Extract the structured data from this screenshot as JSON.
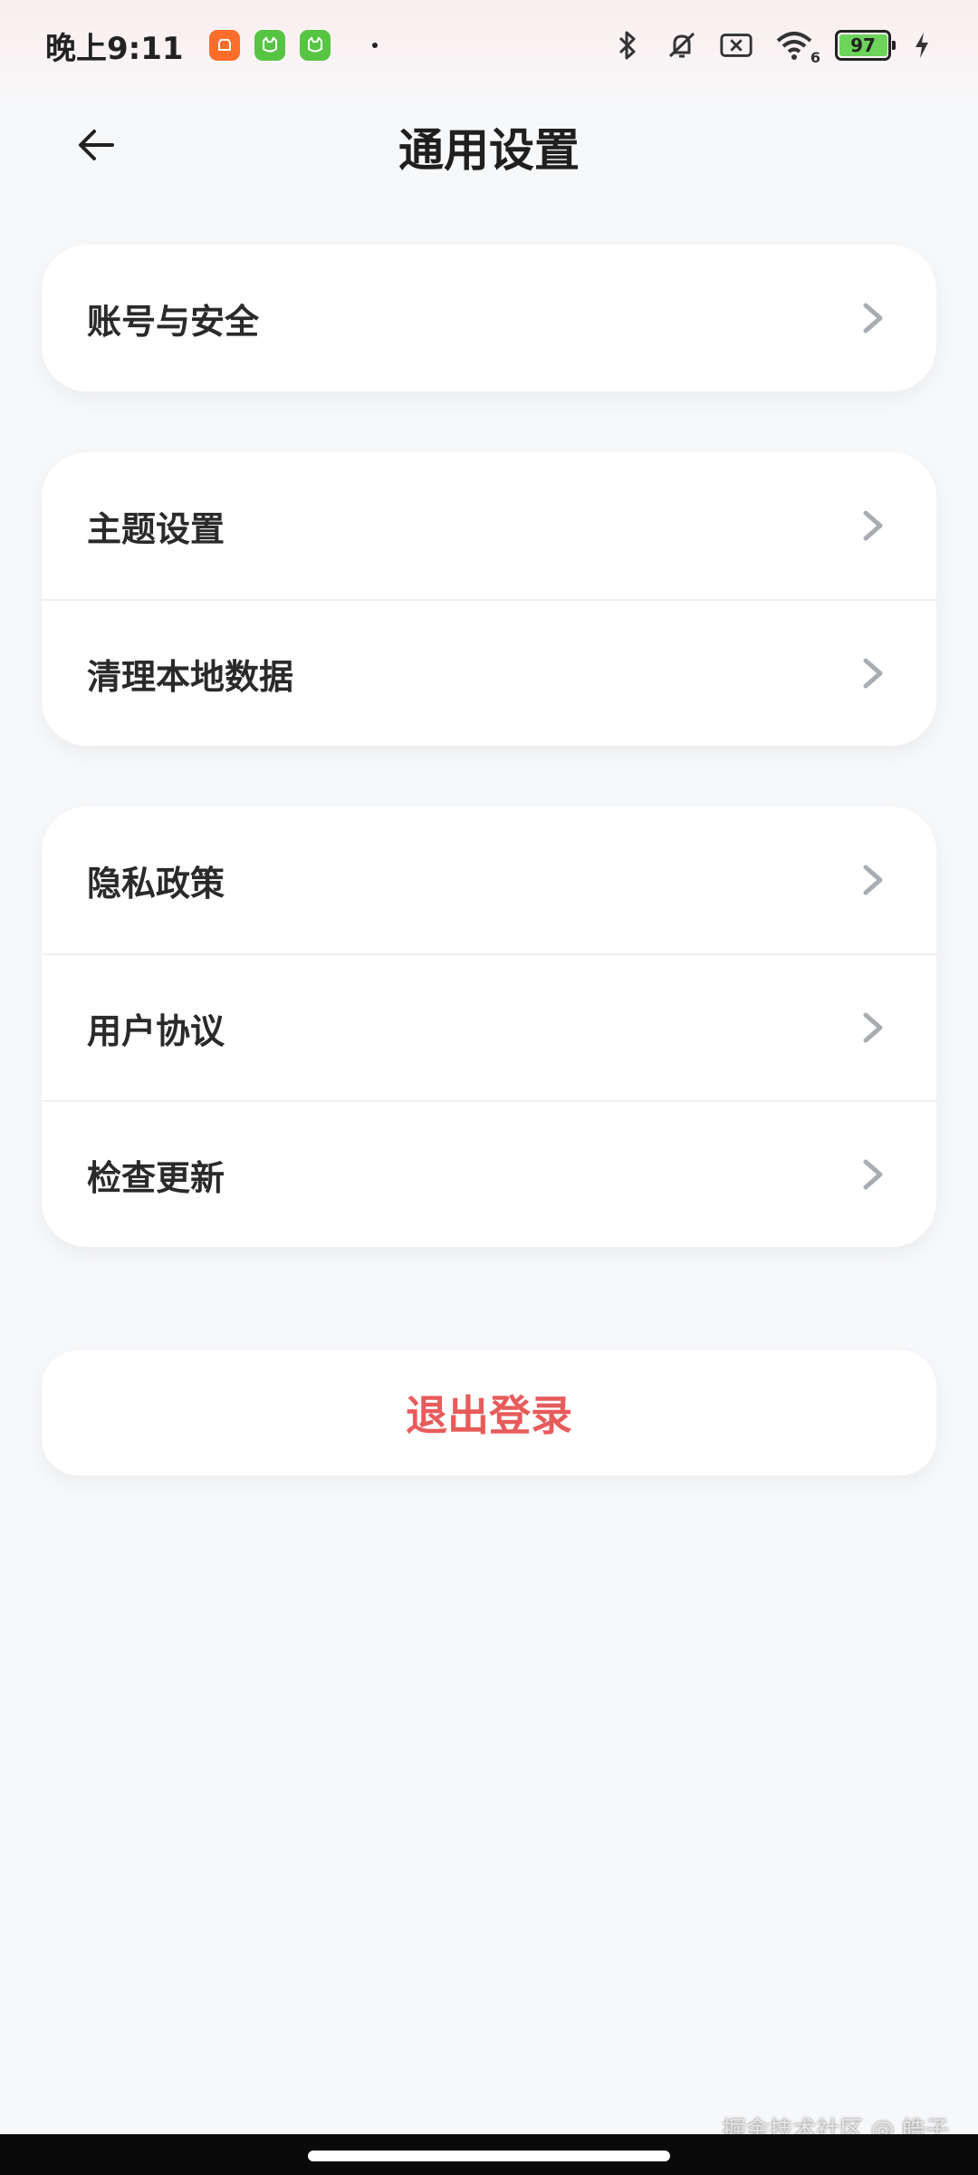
{
  "status_bar": {
    "time": "晚上9:11",
    "battery_level": "97",
    "wifi_badge": "6"
  },
  "header": {
    "title": "通用设置"
  },
  "groups": [
    {
      "items": [
        {
          "label": "账号与安全"
        }
      ]
    },
    {
      "items": [
        {
          "label": "主题设置"
        },
        {
          "label": "清理本地数据"
        }
      ]
    },
    {
      "items": [
        {
          "label": "隐私政策"
        },
        {
          "label": "用户协议"
        },
        {
          "label": "检查更新"
        }
      ]
    }
  ],
  "logout": {
    "label": "退出登录"
  },
  "watermark": "掘金技术社区 @ 皓子",
  "colors": {
    "background": "#f7f8fa",
    "card": "#ffffff",
    "logout_text": "#e85b5b",
    "chevron": "#a9adb2"
  }
}
